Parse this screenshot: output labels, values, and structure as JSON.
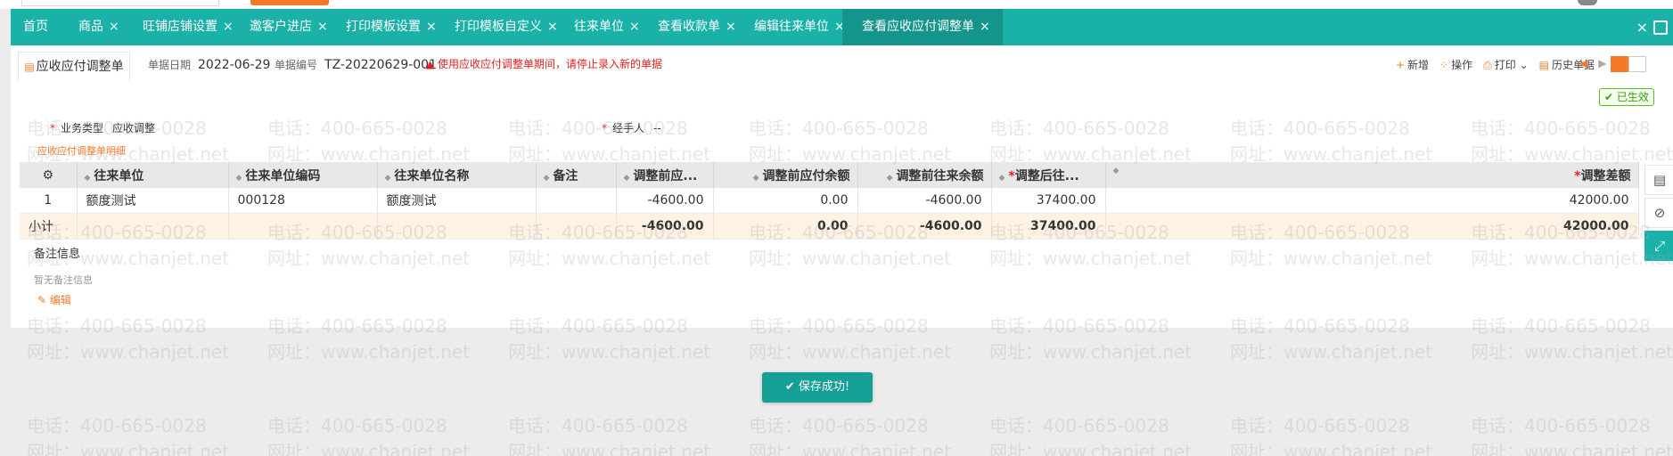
{
  "tabs": [
    {
      "label": "首页",
      "closable": false
    },
    {
      "label": "商品",
      "closable": true
    },
    {
      "label": "旺铺店铺设置",
      "closable": true
    },
    {
      "label": "邀客户进店",
      "closable": true
    },
    {
      "label": "打印模板设置",
      "closable": true
    },
    {
      "label": "打印模板自定义",
      "closable": true
    },
    {
      "label": "往来单位",
      "closable": true
    },
    {
      "label": "查看收款单",
      "closable": true
    },
    {
      "label": "编辑往来单位",
      "closable": true
    },
    {
      "label": "查看应收应付调整单",
      "closable": true,
      "active": true
    }
  ],
  "tab_close_glyph": "×",
  "close_all_glyph": "×",
  "doc": {
    "tab_label": "应收应付调整单",
    "date_label": "单据日期",
    "date_value": "2022-06-29",
    "number_label": "单据编号",
    "number_value": "TZ-20220629-001",
    "warning": "使用应收应付调整单期间，请停止录入新的单据"
  },
  "toolbar": {
    "new": "新增",
    "operate": "操作",
    "print": "打印",
    "history": "历史单据"
  },
  "status": "已生效",
  "fields": {
    "biz_type_label": "业务类型",
    "biz_type_value": "应收调整",
    "handler_label": "经手人",
    "handler_value": "--"
  },
  "section_title": "应收应付调整单明细",
  "table": {
    "headers": [
      "往来单位",
      "往来单位编码",
      "往来单位名称",
      "备注",
      "调整前应...",
      "调整前应付余额",
      "调整前往来余额",
      "调整后往...",
      "调整差额"
    ],
    "rows": [
      {
        "index": "1",
        "cells": [
          "额度测试",
          "000128",
          "额度测试",
          "",
          "-4600.00",
          "0.00",
          "-4600.00",
          "37400.00",
          "42000.00"
        ]
      }
    ],
    "subtotal": {
      "label": "小计",
      "cells": [
        "-4600.00",
        "0.00",
        "-4600.00",
        "37400.00",
        "42000.00"
      ]
    }
  },
  "notes": {
    "title": "备注信息",
    "empty": "暂无备注信息",
    "edit": "编辑"
  },
  "toast": "保存成功!",
  "watermark": {
    "phone": "电话：400-665-0028",
    "site": "网址：www.chanjet.net"
  },
  "colors": {
    "accent": "#1ab2a8",
    "accent_dark": "#14958c",
    "orange": "#f47a2a",
    "error": "#e02020",
    "success": "#389e0d"
  }
}
